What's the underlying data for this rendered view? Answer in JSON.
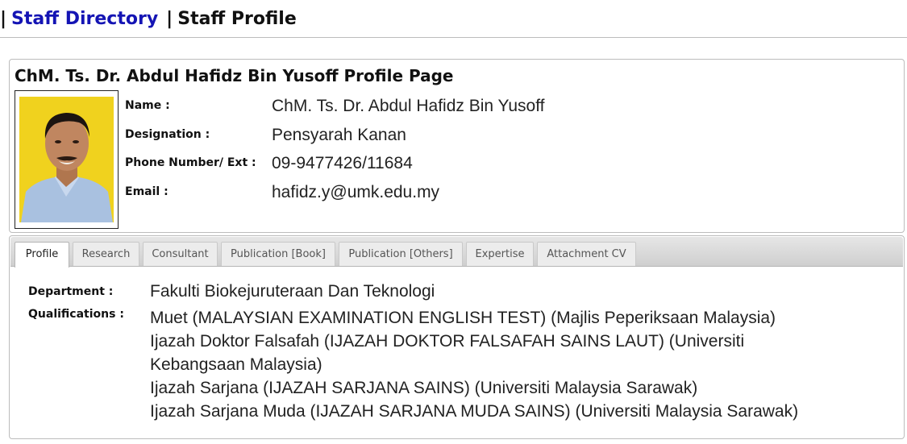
{
  "breadcrumb": {
    "leading_separator": "|",
    "directory_link": "Staff Directory",
    "separator": "|",
    "current_page": "Staff Profile"
  },
  "profile": {
    "page_title": "ChM. Ts. Dr. Abdul Hafidz Bin Yusoff Profile Page",
    "fields": [
      {
        "label": "Name :",
        "value": "ChM. Ts. Dr. Abdul Hafidz Bin Yusoff"
      },
      {
        "label": "Designation :",
        "value": "Pensyarah Kanan"
      },
      {
        "label": "Phone Number/ Ext :",
        "value": "09-9477426/11684"
      },
      {
        "label": "Email :",
        "value": "hafidz.y@umk.edu.my"
      }
    ],
    "photo_background": "#f0d21e"
  },
  "tabs": [
    {
      "label": "Profile",
      "active": true
    },
    {
      "label": "Research",
      "active": false
    },
    {
      "label": "Consultant",
      "active": false
    },
    {
      "label": "Publication [Book]",
      "active": false
    },
    {
      "label": "Publication [Others]",
      "active": false
    },
    {
      "label": "Expertise",
      "active": false
    },
    {
      "label": "Attachment CV",
      "active": false
    }
  ],
  "details": {
    "department_label": "Department :",
    "department_value": "Fakulti Biokejuruteraan Dan Teknologi",
    "qualifications_label": "Qualifications :",
    "qualifications": [
      "Muet (MALAYSIAN EXAMINATION ENGLISH TEST) (Majlis Peperiksaan Malaysia)",
      "Ijazah Doktor Falsafah (IJAZAH DOKTOR FALSAFAH SAINS LAUT) (Universiti Kebangsaan Malaysia)",
      "Ijazah Sarjana (IJAZAH SARJANA SAINS) (Universiti Malaysia Sarawak)",
      "Ijazah Sarjana Muda (IJAZAH SARJANA MUDA SAINS) (Universiti Malaysia Sarawak)"
    ]
  },
  "colors": {
    "link": "#1414b4",
    "border": "#bcbcbc"
  }
}
